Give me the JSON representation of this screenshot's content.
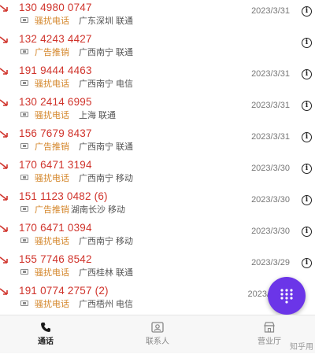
{
  "calls": [
    {
      "number": "130 4980 0747",
      "tag": "骚扰电话",
      "location": "广东深圳 联通",
      "date": "2023/3/31"
    },
    {
      "number": "132 4243 4427",
      "tag": "广告推销",
      "location": "广西南宁 联通",
      "date": ""
    },
    {
      "number": "191 9444 4463",
      "tag": "骚扰电话",
      "location": "广西南宁 电信",
      "date": "2023/3/31"
    },
    {
      "number": "130 2414 6995",
      "tag": "骚扰电话",
      "location": "上海 联通",
      "date": "2023/3/31"
    },
    {
      "number": "156 7679 8437",
      "tag": "广告推销",
      "location": "广西南宁 联通",
      "date": "2023/3/31"
    },
    {
      "number": "170 6471 3194",
      "tag": "骚扰电话",
      "location": "广西南宁 移动",
      "date": "2023/3/30"
    },
    {
      "number": "151 1123 0482 (6)",
      "tag": "广告推销",
      "location": "湖南长沙 移动",
      "date": "2023/3/30"
    },
    {
      "number": "170 6471 0394",
      "tag": "骚扰电话",
      "location": "广西南宁 移动",
      "date": "2023/3/30"
    },
    {
      "number": "155 7746 8542",
      "tag": "骚扰电话",
      "location": "广西桂林 联通",
      "date": "2023/3/29"
    },
    {
      "number": "191 0774 2757 (2)",
      "tag": "骚扰电话",
      "location": "广西梧州 电信",
      "date": "2023/"
    }
  ],
  "tabs": {
    "calls": "通话",
    "contacts": "联系人",
    "hall": "营业厅"
  },
  "watermark": "知乎用",
  "icons": {
    "info": "info-icon",
    "call_arrow": "missed-call-arrow-icon",
    "sim": "sim-card-icon",
    "dialpad": "dialpad-icon",
    "phone": "phone-icon",
    "contacts": "contact-card-icon",
    "hall": "store-icon"
  },
  "colors": {
    "number": "#d0342c",
    "tag": "#d4862a",
    "fab": "#6b35e8"
  }
}
